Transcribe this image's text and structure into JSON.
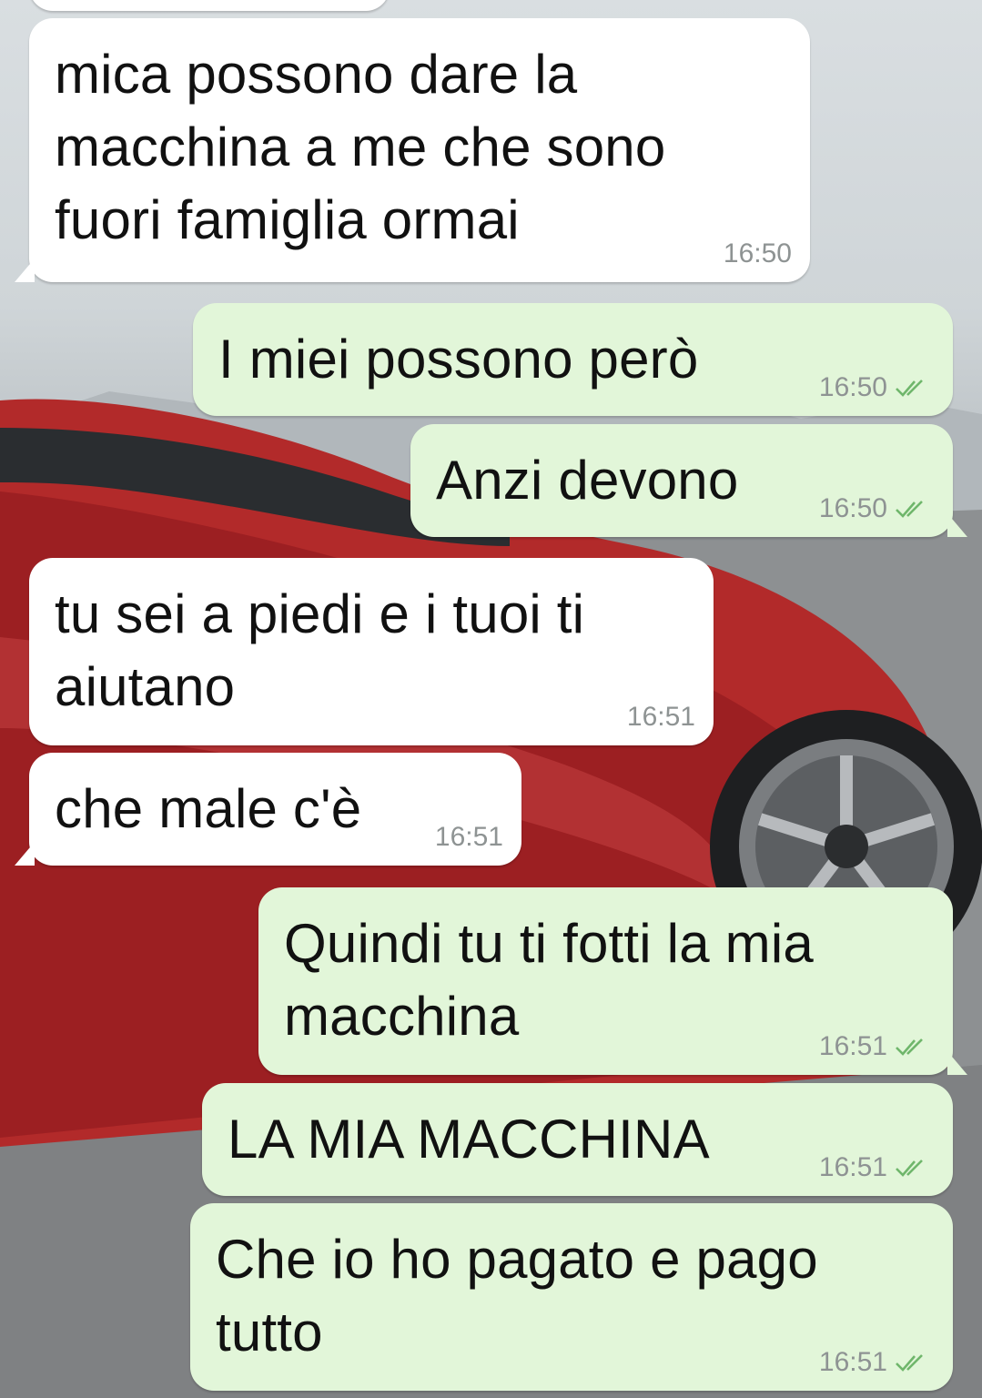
{
  "colors": {
    "incoming_bubble": "#ffffff",
    "outgoing_bubble": "#e2f6d9",
    "timestamp": "#8e9393",
    "read_ticks": "#6fb66b"
  },
  "messages": [
    {
      "direction": "in",
      "text": "mica possono dare la\nmacchina a me che sono\nfuori famiglia ormai",
      "time": "16:50"
    },
    {
      "direction": "out",
      "text": "I miei possono però",
      "time": "16:50",
      "status_icon": "double-check-icon"
    },
    {
      "direction": "out",
      "text": "Anzi devono",
      "time": "16:50",
      "status_icon": "double-check-icon"
    },
    {
      "direction": "in",
      "text": "tu sei a piedi e i tuoi ti\naiutano",
      "time": "16:51"
    },
    {
      "direction": "in",
      "text": "che male c'è",
      "time": "16:51"
    },
    {
      "direction": "out",
      "text": "Quindi tu ti fotti la mia\nmacchina",
      "time": "16:51",
      "status_icon": "double-check-icon"
    },
    {
      "direction": "out",
      "text": "LA MIA MACCHINA",
      "time": "16:51",
      "status_icon": "double-check-icon"
    },
    {
      "direction": "out",
      "text": "Che io ho pagato e pago\ntutto",
      "time": "16:51",
      "status_icon": "double-check-icon"
    }
  ]
}
